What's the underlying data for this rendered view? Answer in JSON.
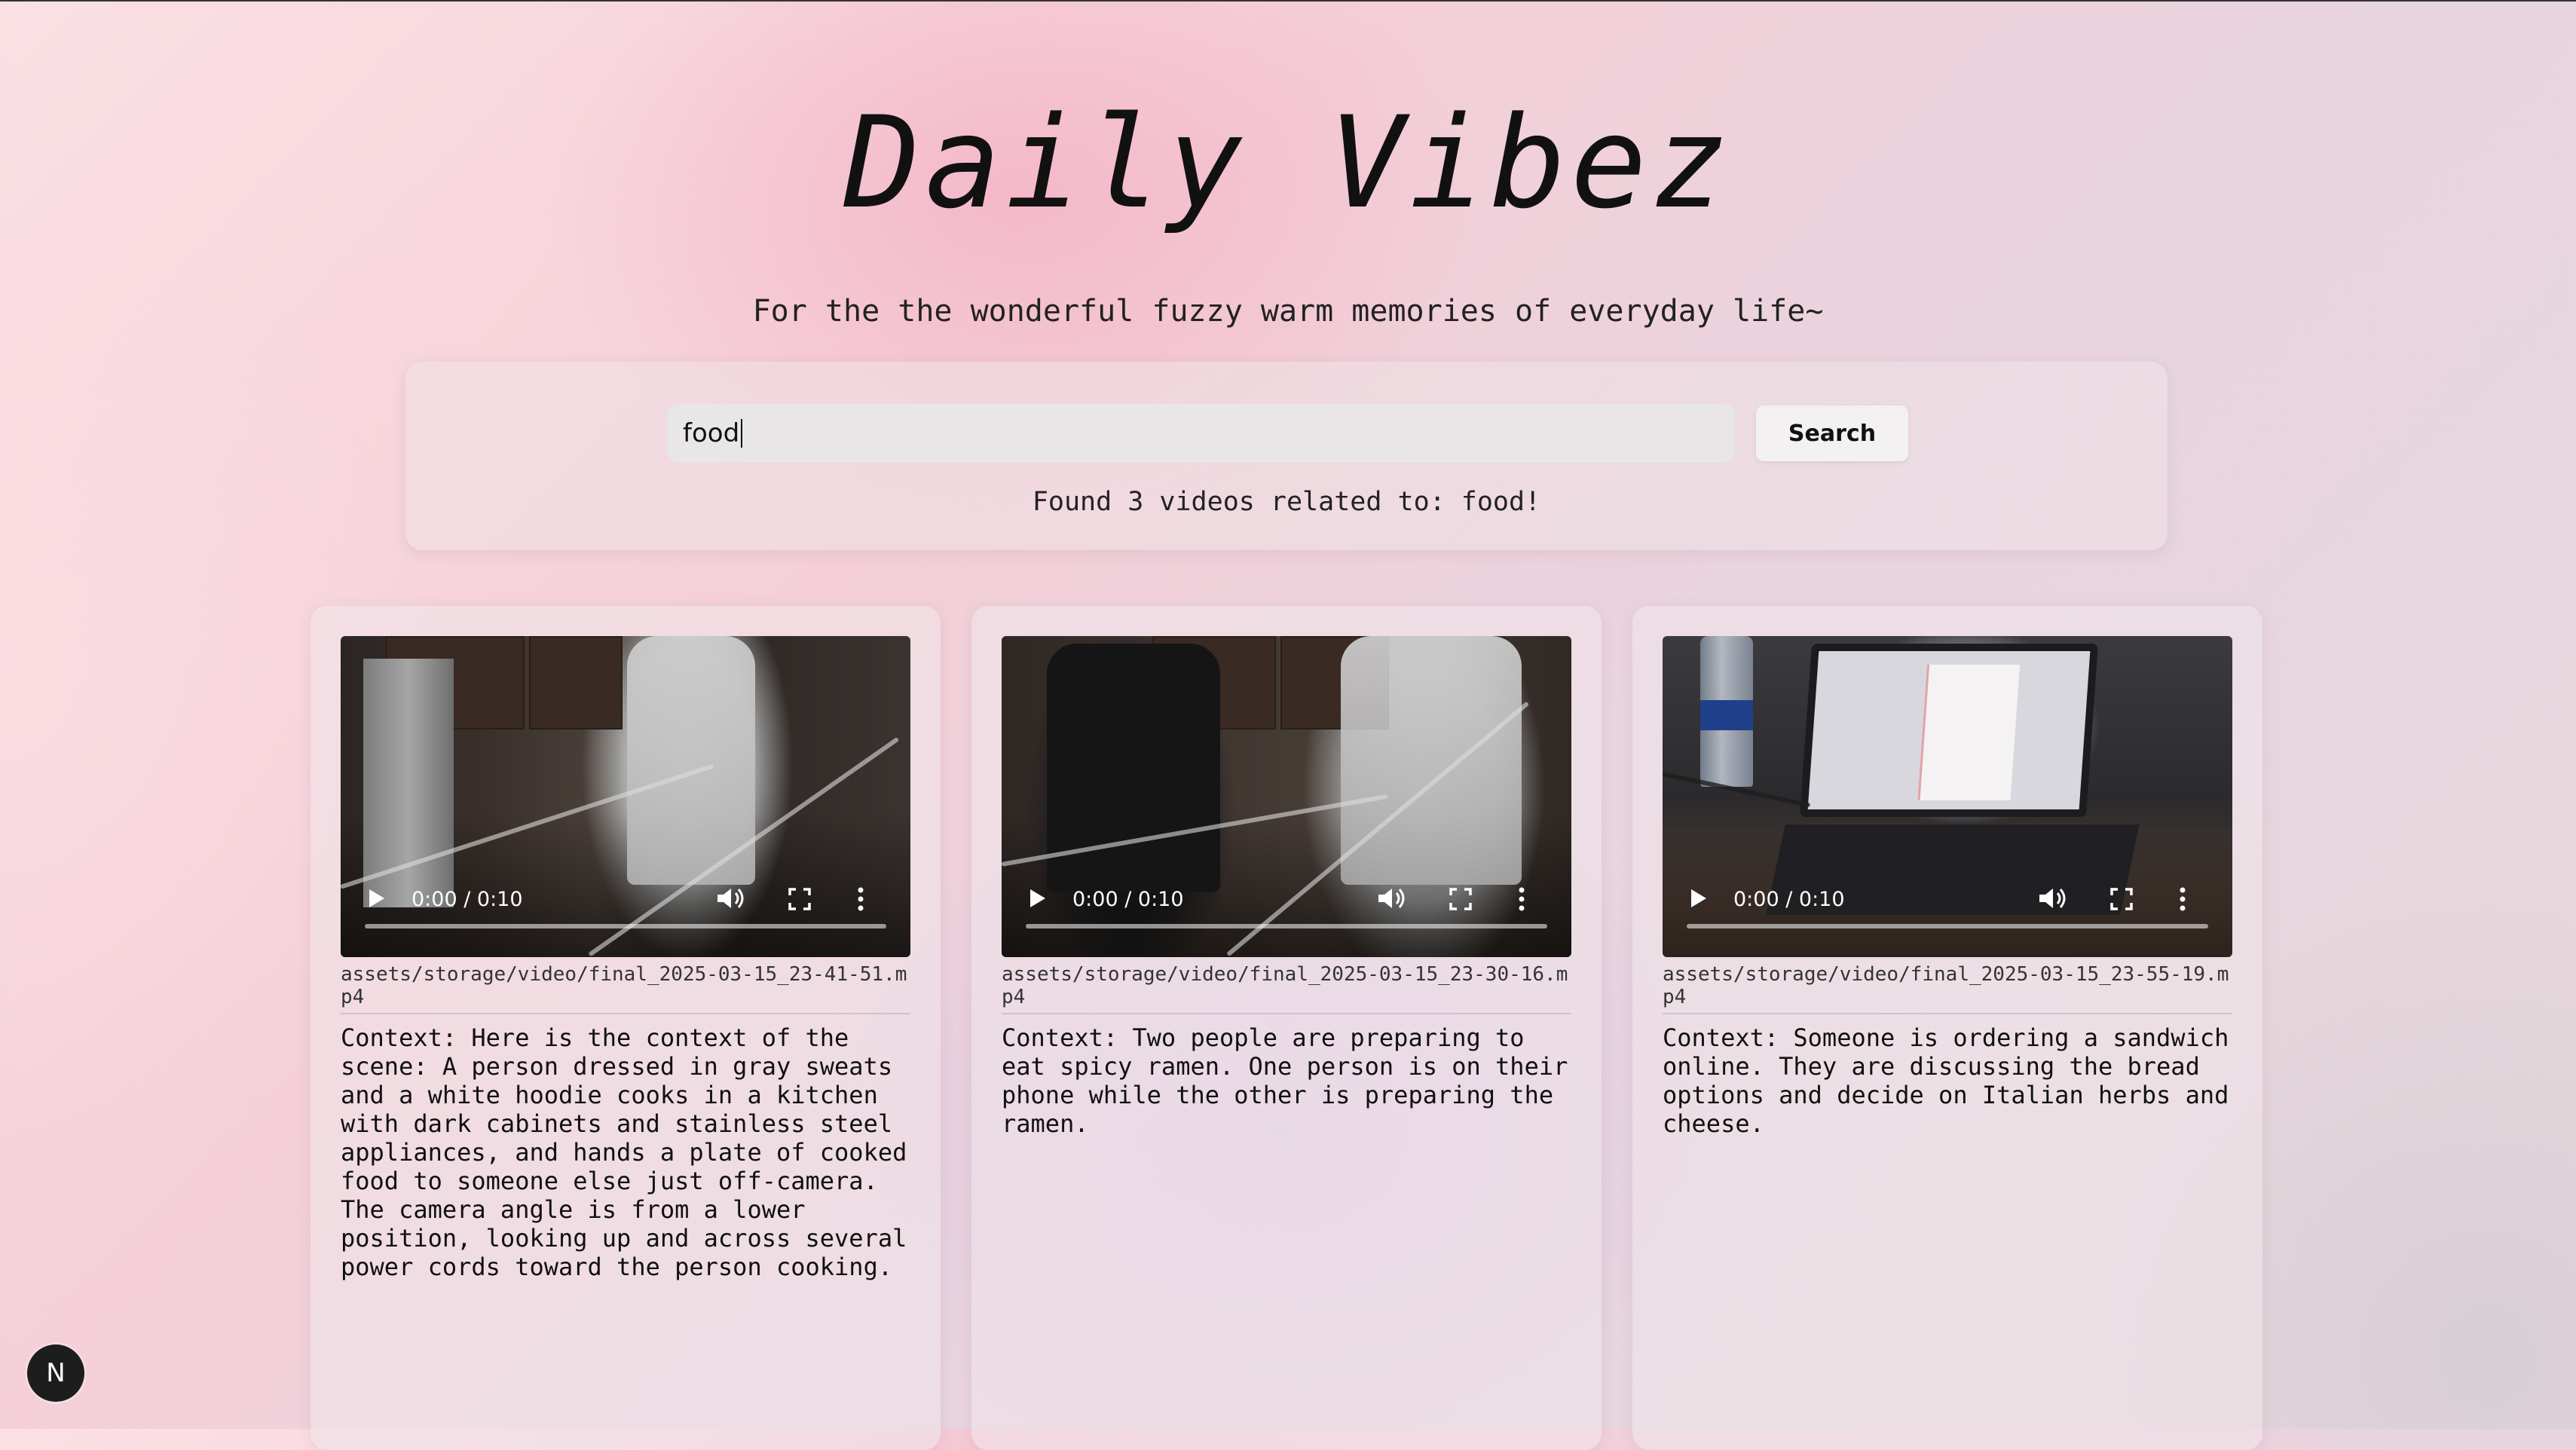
{
  "header": {
    "title": "Daily Vibez",
    "subtitle": "For the the wonderful fuzzy warm memories of everyday life~"
  },
  "search": {
    "value": "food",
    "button_label": "Search",
    "result_status": "Found 3 videos related to: food!"
  },
  "videos": [
    {
      "time": "0:00 / 0:10",
      "progress": 0,
      "path": "assets/storage/video/final_2025-03-15_23-41-51.mp4",
      "context": "Context: Here is the context of the scene: A person dressed in gray sweats and a white hoodie cooks in a kitchen with dark cabinets and stainless steel appliances, and hands a plate of cooked food to someone else just off-camera. The camera angle is from a lower position, looking up and across several power cords toward the person cooking."
    },
    {
      "time": "0:00 / 0:10",
      "progress": 0,
      "path": "assets/storage/video/final_2025-03-15_23-30-16.mp4",
      "context": "Context: Two people are preparing to eat spicy ramen. One person is on their phone while the other is preparing the ramen."
    },
    {
      "time": "0:00 / 0:10",
      "progress": 0,
      "path": "assets/storage/video/final_2025-03-15_23-55-19.mp4",
      "context": "Context: Someone is ordering a sandwich online. They are discussing the bread options and decide on Italian herbs and cheese."
    }
  ],
  "dev_badge": {
    "letter": "N"
  }
}
